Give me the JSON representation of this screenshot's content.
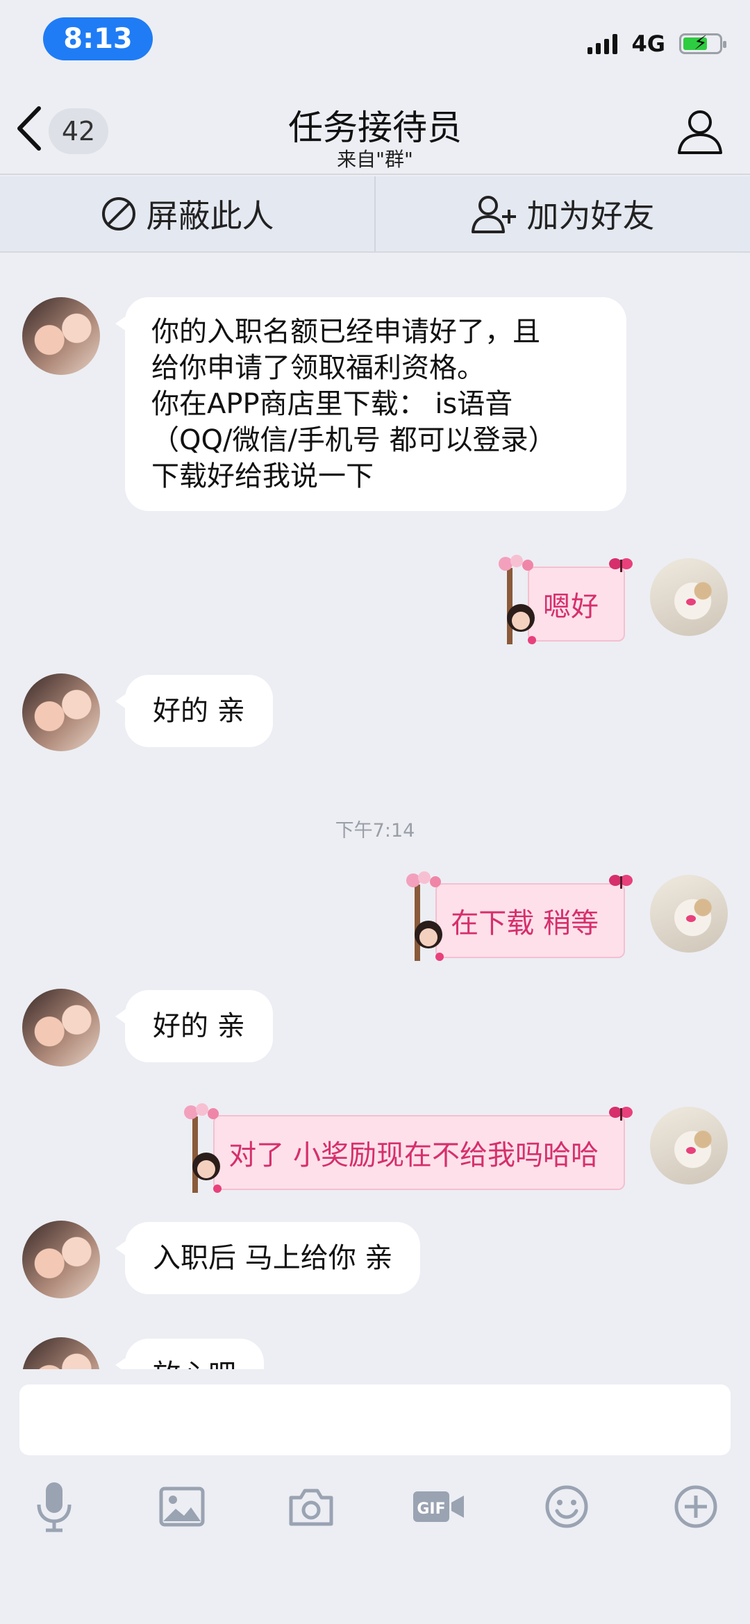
{
  "status_bar": {
    "time": "8:13",
    "network": "4G"
  },
  "header": {
    "unread_count": "42",
    "title": "任务接待员",
    "subtitle": "来自\"群\""
  },
  "actions": {
    "block_label": "屏蔽此人",
    "add_friend_label": "加为好友"
  },
  "messages": [
    {
      "side": "left",
      "lines": [
        "你的入职名额已经申请好了，且",
        "给你申请了领取福利资格。",
        "你在APP商店里下载： is语音",
        "（QQ/微信/手机号  都可以登录）",
        "下载好给我说一下"
      ]
    },
    {
      "side": "right",
      "text": "嗯好"
    },
    {
      "side": "left",
      "text": "好的 亲"
    },
    {
      "timestamp": "下午7:14"
    },
    {
      "side": "right",
      "text": "在下载  稍等"
    },
    {
      "side": "left",
      "text": "好的  亲"
    },
    {
      "side": "right",
      "text": "对了 小奖励现在不给我吗哈哈"
    },
    {
      "side": "left",
      "text": "入职后 马上给你 亲"
    },
    {
      "side": "left",
      "text": "放心吧"
    }
  ],
  "input": {
    "value": ""
  },
  "toolbar_icons": [
    "microphone-icon",
    "image-icon",
    "camera-icon",
    "gif-icon",
    "emoji-icon",
    "plus-icon"
  ]
}
